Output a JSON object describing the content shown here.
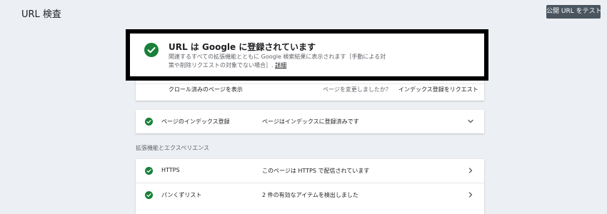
{
  "header": {
    "title": "URL 検査",
    "test_live_button": "公開 URL をテスト"
  },
  "status": {
    "headline": "URL は Google に登録されています",
    "description": "関連するすべての拡張機能とともに Google 検索結果に表示されます［手動による対策や削除リクエストの対象でない場合］",
    "details_link": "詳細",
    "crawled_link": "クロール済みのページを表示",
    "changed_question": "ページを変更しましたか？",
    "request_indexing": "インデックス登録をリクエスト",
    "colors": {
      "success": "#188038"
    }
  },
  "coverage": {
    "label": "ページのインデックス登録",
    "value": "ページはインデックスに登録済みです",
    "icon": "chevron-down-icon"
  },
  "enhancements": {
    "heading": "拡張機能とエクスペリエンス",
    "items": [
      {
        "label": "HTTPS",
        "value": "このページは HTTPS で配信されています",
        "icon": "chevron-right-icon"
      },
      {
        "label": "パンくずリスト",
        "value": "2 件の有効なアイテムを検出しました",
        "icon": "chevron-right-icon"
      }
    ]
  }
}
